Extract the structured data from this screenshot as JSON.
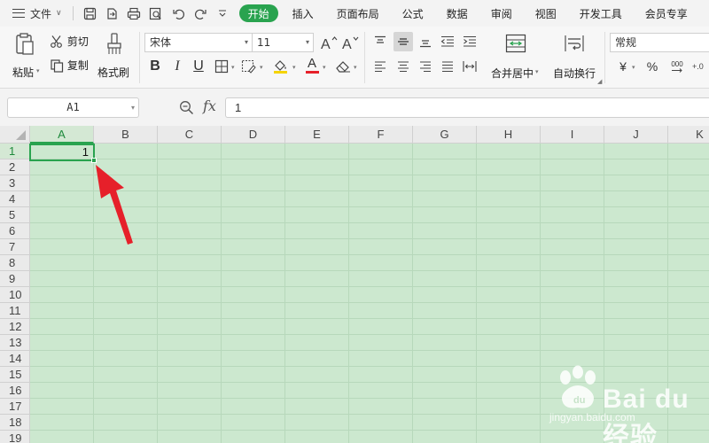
{
  "menubar": {
    "file_label": "文件",
    "tabs": [
      {
        "label": "开始",
        "active": true
      },
      {
        "label": "插入"
      },
      {
        "label": "页面布局"
      },
      {
        "label": "公式"
      },
      {
        "label": "数据"
      },
      {
        "label": "审阅"
      },
      {
        "label": "视图"
      },
      {
        "label": "开发工具"
      },
      {
        "label": "会员专享"
      }
    ]
  },
  "ribbon": {
    "paste_label": "粘贴",
    "cut_label": "剪切",
    "copy_label": "复制",
    "format_painter_label": "格式刷",
    "font_name": "宋体",
    "font_size": "11",
    "bold": "B",
    "italic": "I",
    "underline": "U",
    "font_color_letter": "A",
    "merge_center_label": "合并居中",
    "wrap_text_label": "自动换行",
    "number_format": "常规",
    "currency_symbol": "¥",
    "percent_symbol": "%",
    "thousands_symbol": "000"
  },
  "formula_bar": {
    "cell_ref": "A1",
    "fx_label": "fx",
    "value": "1"
  },
  "sheet": {
    "columns": [
      "A",
      "B",
      "C",
      "D",
      "E",
      "F",
      "G",
      "H",
      "I",
      "J",
      "K"
    ],
    "rows": [
      "1",
      "2",
      "3",
      "4",
      "5",
      "6",
      "7",
      "8",
      "9",
      "10",
      "11",
      "12",
      "13",
      "14",
      "15",
      "16",
      "17",
      "18",
      "19"
    ],
    "active_column": "A",
    "active_row": "1",
    "active_cell_value": "1"
  },
  "watermark": {
    "brand": "Bai du 经验",
    "url": "jingyan.baidu.com"
  },
  "colors": {
    "accent": "#29a34f",
    "cell_bg": "#cce8cf",
    "arrow": "#e6202a"
  }
}
